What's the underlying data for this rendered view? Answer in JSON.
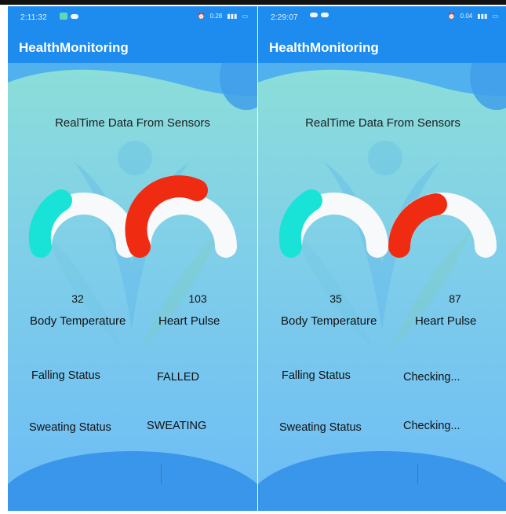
{
  "screens": [
    {
      "status_time": "2:11:32",
      "status_right": "0.28",
      "app_title": "HealthMonitoring",
      "heading": "RealTime Data From Sensors",
      "temperature": {
        "value": "32",
        "label": "Body Temperature"
      },
      "pulse": {
        "value": "103",
        "label": "Heart Pulse"
      },
      "falling": {
        "label": "Falling Status",
        "value": "FALLED"
      },
      "sweating": {
        "label": "Sweating Status",
        "value": "SWEATING"
      }
    },
    {
      "status_time": "2:29:07",
      "status_right": "0.04",
      "app_title": "HealthMonitoring",
      "heading": "RealTime Data From Sensors",
      "temperature": {
        "value": "35",
        "label": "Body Temperature"
      },
      "pulse": {
        "value": "87",
        "label": "Heart Pulse"
      },
      "falling": {
        "label": "Falling Status",
        "value": "Checking..."
      },
      "sweating": {
        "label": "Sweating Status",
        "value": "Checking..."
      }
    }
  ],
  "colors": {
    "appbar": "#1e8cef",
    "gauge_track": "#f7f9fa",
    "temperature_arc": "#19e3d7",
    "pulse_arc": "#ef2b12"
  },
  "icons": [
    "alarm-icon",
    "wifi-icon",
    "signal-icon",
    "battery-icon",
    "cloud-icon"
  ]
}
